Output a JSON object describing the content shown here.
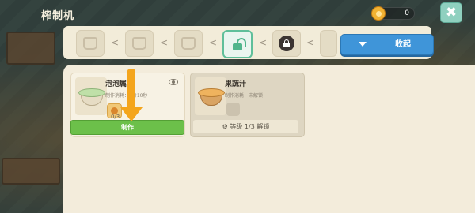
{
  "header": {
    "title": "榨制机",
    "coins": "0"
  },
  "tabs": {
    "collapse_label": "收起",
    "separator": "<"
  },
  "recipes": [
    {
      "name": "泡泡属",
      "subtitle": "制作消耗：4分10秒",
      "ingredient_count": "0/3",
      "action_label": "制作"
    },
    {
      "name": "果蔬汁",
      "subtitle": "制作消耗：未解锁",
      "action_label": "等级 1/3 解锁"
    }
  ],
  "colors": {
    "accent": "#3f95d9",
    "make_button": "#6cc04a",
    "guide_arrow": "#f4a51c"
  },
  "icons": [
    "coin-icon",
    "close-icon",
    "crown-icon",
    "lock-open-icon",
    "lock-closed-icon",
    "chevron-down-icon",
    "eye-icon",
    "gear-icon"
  ]
}
